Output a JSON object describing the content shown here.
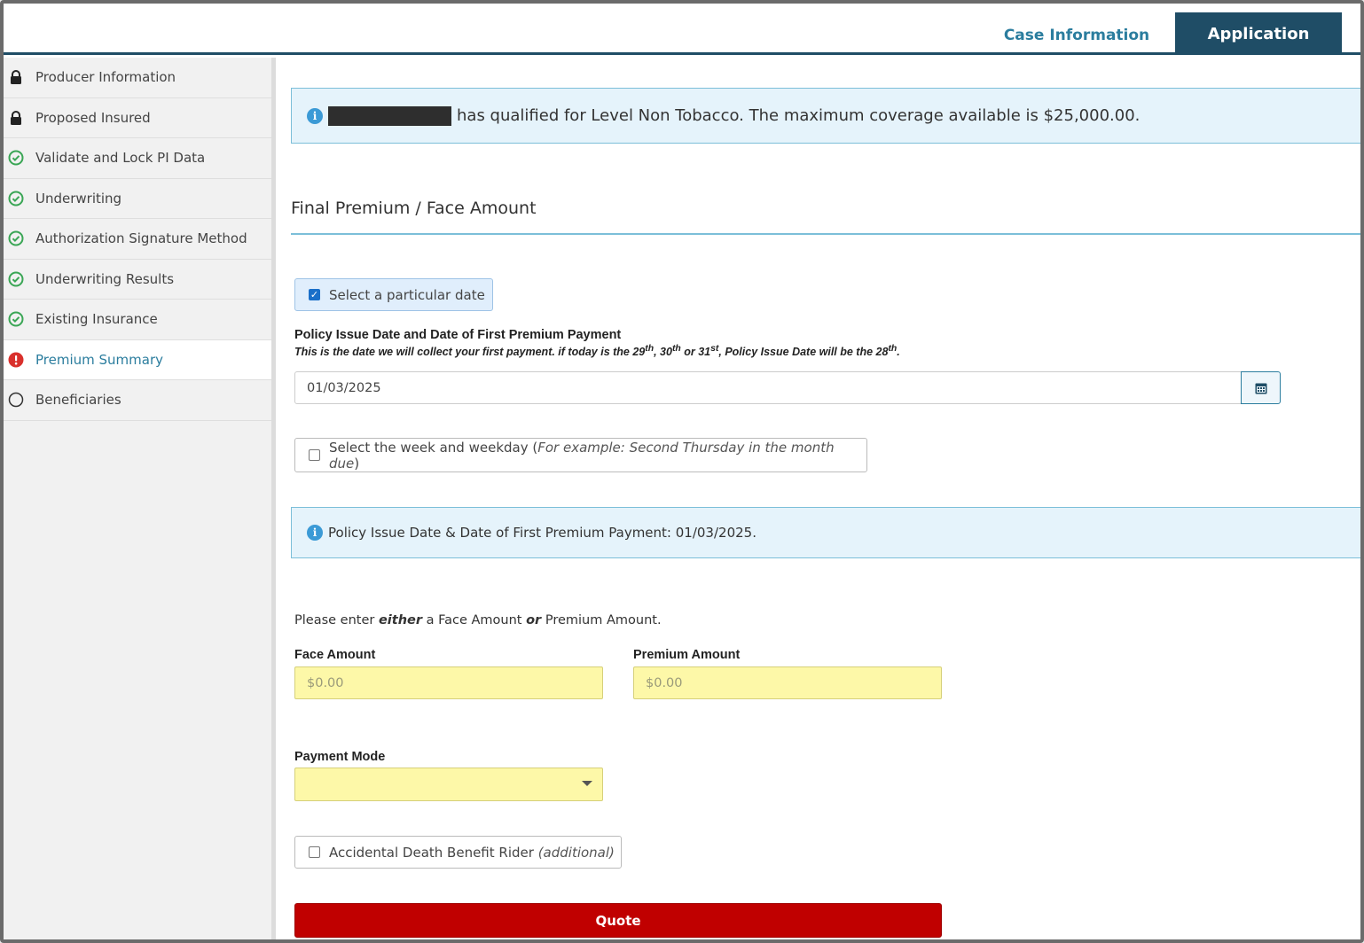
{
  "tabs": {
    "case_information": "Case Information",
    "application": "Application"
  },
  "sidebar": {
    "items": [
      {
        "label": "Producer Information",
        "status": "locked"
      },
      {
        "label": "Proposed Insured",
        "status": "locked"
      },
      {
        "label": "Validate and Lock PI Data",
        "status": "complete"
      },
      {
        "label": "Underwriting",
        "status": "complete"
      },
      {
        "label": "Authorization Signature Method",
        "status": "complete"
      },
      {
        "label": "Underwriting Results",
        "status": "complete"
      },
      {
        "label": "Existing Insurance",
        "status": "complete"
      },
      {
        "label": "Premium Summary",
        "status": "error"
      },
      {
        "label": "Beneficiaries",
        "status": "incomplete"
      }
    ]
  },
  "alert_qualified": {
    "text": "has qualified for Level Non Tobacco. The maximum coverage available is $25,000.00."
  },
  "section": {
    "title": "Final Premium / Face Amount"
  },
  "date_option": {
    "label": "Select a particular date",
    "checked": true
  },
  "policy_date": {
    "label": "Policy Issue Date and Date of First Premium Payment",
    "hint_part1": "This is the date we will collect your first payment. if today is the 29",
    "hint_sup1": "th",
    "hint_part2": ", 30",
    "hint_sup2": "th",
    "hint_part3": " or 31",
    "hint_sup3": "st",
    "hint_part4": ", Policy Issue Date will be the 28",
    "hint_sup4": "th",
    "hint_part5": ".",
    "value": "01/03/2025"
  },
  "week_option": {
    "label": "Select the week and weekday (",
    "example": "For example: Second Thursday in the month due",
    "close": ")",
    "checked": false
  },
  "alert_policy": {
    "text": "Policy Issue Date & Date of First Premium Payment: 01/03/2025."
  },
  "amount_prompt": {
    "part1": "Please enter ",
    "either": "either",
    "part2": " a Face Amount ",
    "or": "or",
    "part3": " Premium Amount."
  },
  "face_amount": {
    "label": "Face Amount",
    "placeholder": "$0.00"
  },
  "premium_amount": {
    "label": "Premium Amount",
    "placeholder": "$0.00"
  },
  "payment_mode": {
    "label": "Payment Mode",
    "value": ""
  },
  "adb_rider": {
    "label": "Accidental Death Benefit Rider ",
    "note": "(additional)",
    "checked": false
  },
  "quote_button": {
    "label": "Quote"
  },
  "colors": {
    "header_navy": "#1f4d66",
    "accent_teal": "#2b7d9e",
    "alert_bg": "#e5f3fb",
    "required_yellow": "#fdf8a8",
    "quote_red": "#c00000",
    "complete_green": "#3aa655",
    "error_red": "#d9302c"
  }
}
